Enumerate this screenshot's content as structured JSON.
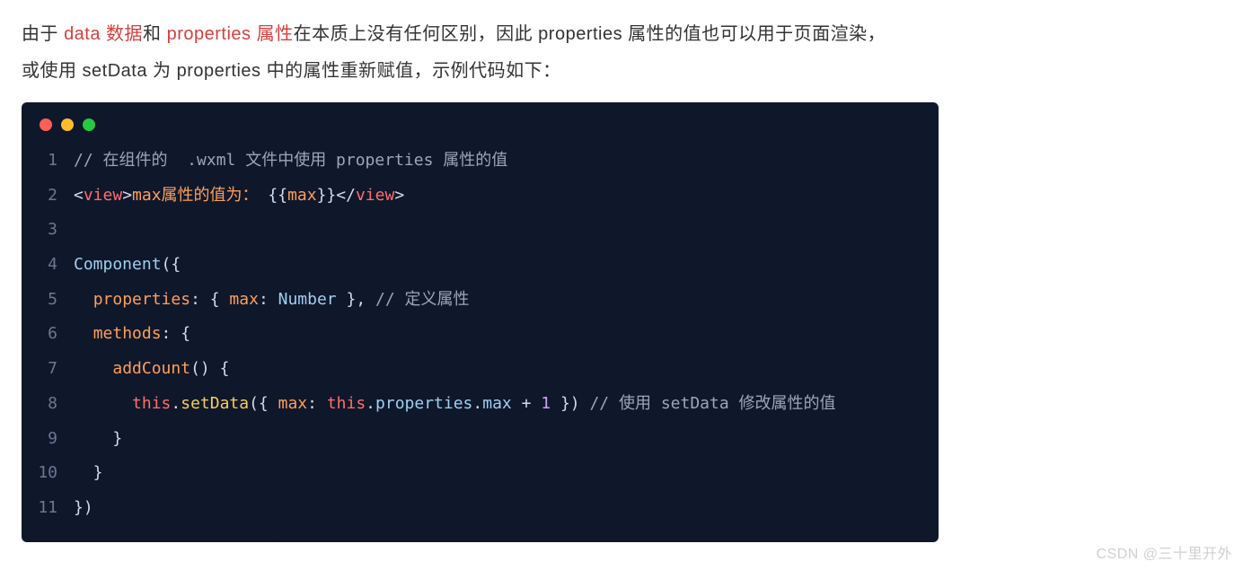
{
  "prose": {
    "p1_a": "由于 ",
    "p1_b": "data 数据",
    "p1_c": "和 ",
    "p1_d": "properties 属性",
    "p1_e": "在本质上没有任何区别，因此 properties 属性的值也可以用于页面渲染，",
    "p2": "或使用 setData 为 properties 中的属性重新赋值，示例代码如下："
  },
  "code": {
    "lines": [
      {
        "n": "1",
        "tokens": [
          {
            "c": "tk-cmt",
            "t": "// 在组件的  .wxml 文件中使用 properties 属性的值"
          }
        ]
      },
      {
        "n": "2",
        "tokens": [
          {
            "c": "tk-punc",
            "t": "<"
          },
          {
            "c": "tk-tag",
            "t": "view"
          },
          {
            "c": "tk-punc",
            "t": ">"
          },
          {
            "c": "tk-attr",
            "t": "max属性的值为："
          },
          {
            "c": "tk-str",
            "t": " {{"
          },
          {
            "c": "tk-attr",
            "t": "max"
          },
          {
            "c": "tk-str",
            "t": "}}"
          },
          {
            "c": "tk-punc",
            "t": "</"
          },
          {
            "c": "tk-tag",
            "t": "view"
          },
          {
            "c": "tk-punc",
            "t": ">"
          }
        ]
      },
      {
        "n": "3",
        "tokens": [
          {
            "c": "tk-str",
            "t": ""
          }
        ]
      },
      {
        "n": "4",
        "tokens": [
          {
            "c": "tk-ident",
            "t": "Component"
          },
          {
            "c": "tk-punc",
            "t": "({"
          }
        ]
      },
      {
        "n": "5",
        "tokens": [
          {
            "c": "tk-str",
            "t": "  "
          },
          {
            "c": "tk-key",
            "t": "properties"
          },
          {
            "c": "tk-punc",
            "t": ": { "
          },
          {
            "c": "tk-key",
            "t": "max"
          },
          {
            "c": "tk-punc",
            "t": ": "
          },
          {
            "c": "tk-ident",
            "t": "Number"
          },
          {
            "c": "tk-punc",
            "t": " }, "
          },
          {
            "c": "tk-cmt",
            "t": "// 定义属性"
          }
        ]
      },
      {
        "n": "6",
        "tokens": [
          {
            "c": "tk-str",
            "t": "  "
          },
          {
            "c": "tk-key",
            "t": "methods"
          },
          {
            "c": "tk-punc",
            "t": ": {"
          }
        ]
      },
      {
        "n": "7",
        "tokens": [
          {
            "c": "tk-str",
            "t": "    "
          },
          {
            "c": "tk-fn",
            "t": "addCount"
          },
          {
            "c": "tk-punc",
            "t": "() {"
          }
        ]
      },
      {
        "n": "8",
        "tokens": [
          {
            "c": "tk-str",
            "t": "      "
          },
          {
            "c": "tk-this",
            "t": "this"
          },
          {
            "c": "tk-punc",
            "t": "."
          },
          {
            "c": "tk-call",
            "t": "setData"
          },
          {
            "c": "tk-punc",
            "t": "({ "
          },
          {
            "c": "tk-key",
            "t": "max"
          },
          {
            "c": "tk-punc",
            "t": ": "
          },
          {
            "c": "tk-this",
            "t": "this"
          },
          {
            "c": "tk-punc",
            "t": "."
          },
          {
            "c": "tk-ident",
            "t": "properties"
          },
          {
            "c": "tk-punc",
            "t": "."
          },
          {
            "c": "tk-ident",
            "t": "max"
          },
          {
            "c": "tk-punc",
            "t": " + "
          },
          {
            "c": "tk-num",
            "t": "1"
          },
          {
            "c": "tk-punc",
            "t": " }) "
          },
          {
            "c": "tk-cmt",
            "t": "// 使用 setData 修改属性的值"
          }
        ]
      },
      {
        "n": "9",
        "tokens": [
          {
            "c": "tk-punc",
            "t": "    }"
          }
        ]
      },
      {
        "n": "10",
        "tokens": [
          {
            "c": "tk-punc",
            "t": "  }"
          }
        ]
      },
      {
        "n": "11",
        "tokens": [
          {
            "c": "tk-punc",
            "t": "})"
          }
        ]
      }
    ]
  },
  "watermark": "CSDN @三十里开外"
}
